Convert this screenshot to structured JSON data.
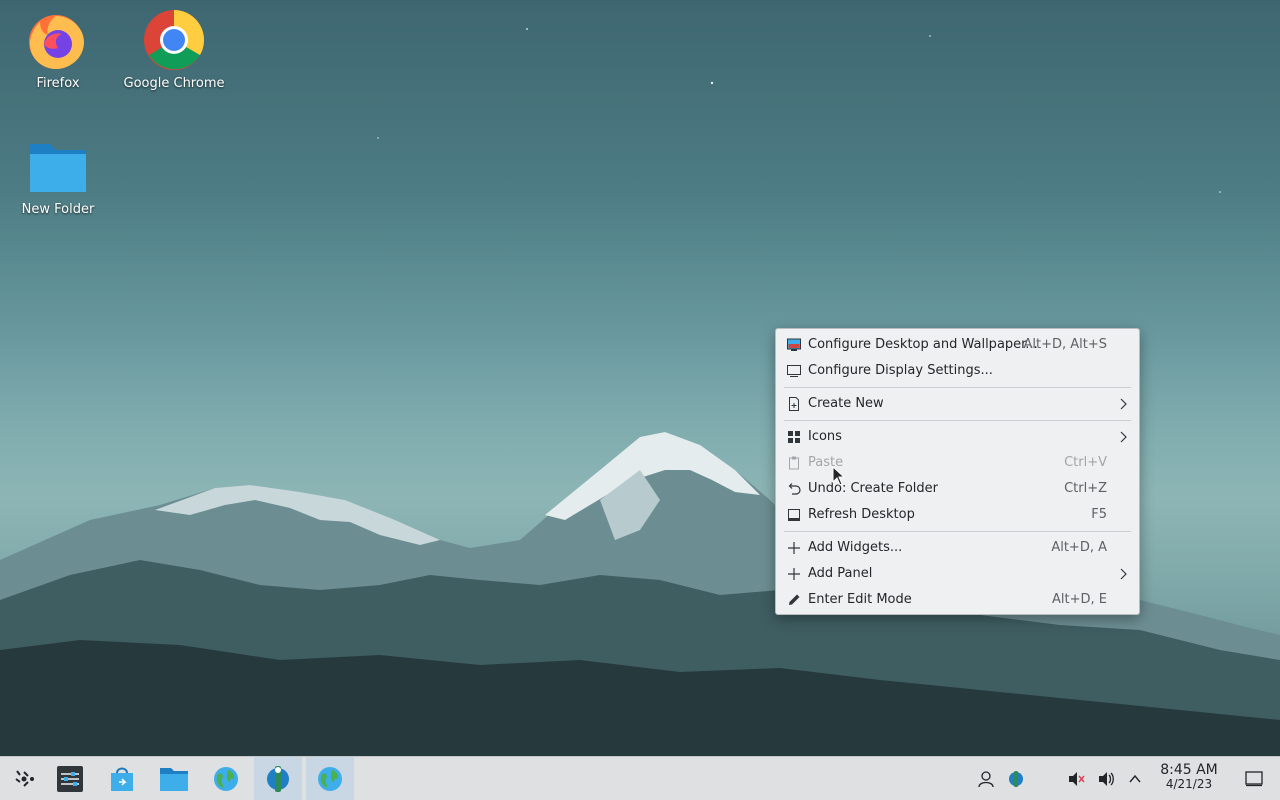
{
  "desktop": {
    "icons": [
      {
        "label": "Firefox",
        "icon": "firefox-icon"
      },
      {
        "label": "Google Chrome",
        "icon": "chrome-icon"
      },
      {
        "label": "New Folder",
        "icon": "folder-icon"
      }
    ]
  },
  "context_menu": {
    "items": [
      {
        "label": "Configure Desktop and Wallpaper...",
        "shortcut": "Alt+D, Alt+S",
        "icon": "wallpaper-icon"
      },
      {
        "label": "Configure Display Settings...",
        "shortcut": "",
        "icon": "display-icon"
      },
      {
        "label": "Create New",
        "shortcut": "",
        "icon": "new-document-icon",
        "submenu": true
      },
      {
        "label": "Icons",
        "shortcut": "",
        "icon": "icons-grid-icon",
        "submenu": true
      },
      {
        "label": "Paste",
        "shortcut": "Ctrl+V",
        "icon": "paste-icon",
        "disabled": true
      },
      {
        "label": "Undo: Create Folder",
        "shortcut": "Ctrl+Z",
        "icon": "undo-icon"
      },
      {
        "label": "Refresh Desktop",
        "shortcut": "F5",
        "icon": "refresh-icon"
      },
      {
        "label": "Add Widgets...",
        "shortcut": "Alt+D, A",
        "icon": "plus-icon"
      },
      {
        "label": "Add Panel",
        "shortcut": "",
        "icon": "plus-icon",
        "submenu": true
      },
      {
        "label": "Enter Edit Mode",
        "shortcut": "Alt+D, E",
        "icon": "pencil-icon"
      }
    ]
  },
  "taskbar": {
    "clock": {
      "time": "8:45 AM",
      "date": "4/21/23"
    },
    "launchers": [
      "application-launcher-icon",
      "settings-icon",
      "discover-store-icon",
      "file-manager-icon",
      "browser-globe-icon",
      "network-app-icon",
      "browser-globe-icon"
    ],
    "tray": [
      "user-icon",
      "network-app-icon",
      "muted-mic-icon",
      "volume-icon",
      "tray-expand-icon",
      "show-desktop-icon"
    ]
  },
  "colors": {
    "accent": "#3daee9",
    "menu_bg": "#eff0f1",
    "taskbar_bg": "#dee0e2"
  }
}
